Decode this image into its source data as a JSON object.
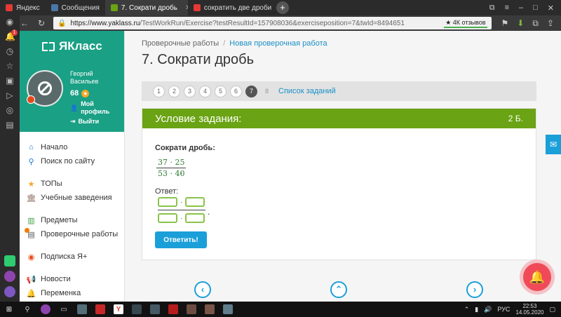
{
  "browser": {
    "tabs": [
      {
        "label": "Яндекс",
        "color": "#e53935",
        "active": false
      },
      {
        "label": "Сообщения",
        "color": "#4a76a8",
        "active": false
      },
      {
        "label": "7. Сократи дробь",
        "color": "#6aa313",
        "active": true
      },
      {
        "label": "сократить две дроби онл",
        "color": "#e53935",
        "active": false
      }
    ],
    "url_host": "https://www.yaklass.ru",
    "url_rest": "/TestWorkRun/Exercise?testResultId=157908036&exerciseposition=7&twId=8494651",
    "reviews_badge": "★ 4К отзывов",
    "notification_count": "1"
  },
  "site": {
    "logo": "ЯКласс",
    "user": {
      "first": "Георгий",
      "last": "Васильев",
      "score": "68"
    },
    "profile_link": "Мой профиль",
    "logout_link": "Выйти",
    "menu": [
      {
        "label": "Начало",
        "icon": "home-icon"
      },
      {
        "label": "Поиск по сайту",
        "icon": "search-icon"
      },
      {
        "label": "ТОПы",
        "icon": "star-icon"
      },
      {
        "label": "Учебные заведения",
        "icon": "school-icon"
      },
      {
        "label": "Предметы",
        "icon": "books-icon"
      },
      {
        "label": "Проверочные работы",
        "icon": "tests-icon"
      },
      {
        "label": "Подписка Я+",
        "icon": "subscription-icon"
      },
      {
        "label": "Новости",
        "icon": "news-icon"
      },
      {
        "label": "Переменка",
        "icon": "break-icon"
      }
    ]
  },
  "main": {
    "breadcrumb_1": "Проверочные работы",
    "breadcrumb_2": "Новая проверочная работа",
    "title": "7. Сократи дробь",
    "pages": [
      "1",
      "2",
      "3",
      "4",
      "5",
      "6",
      "7",
      "8"
    ],
    "current_page": "7",
    "task_list_link": "Список заданий",
    "card_title": "Условие задания:",
    "points": "2 Б.",
    "task_text": "Сократи дробь:",
    "numerator": "37 · 25",
    "denominator": "53 · 40",
    "answer_label": "Ответ:",
    "submit_label": "Ответить!"
  },
  "taskbar": {
    "lang": "РУС",
    "time": "22:53",
    "date": "14.05.2020"
  },
  "colors": {
    "brand_teal": "#1aa085",
    "card_green": "#6aa313",
    "link_blue": "#1a9fd9",
    "bell_red": "#f04a59"
  }
}
